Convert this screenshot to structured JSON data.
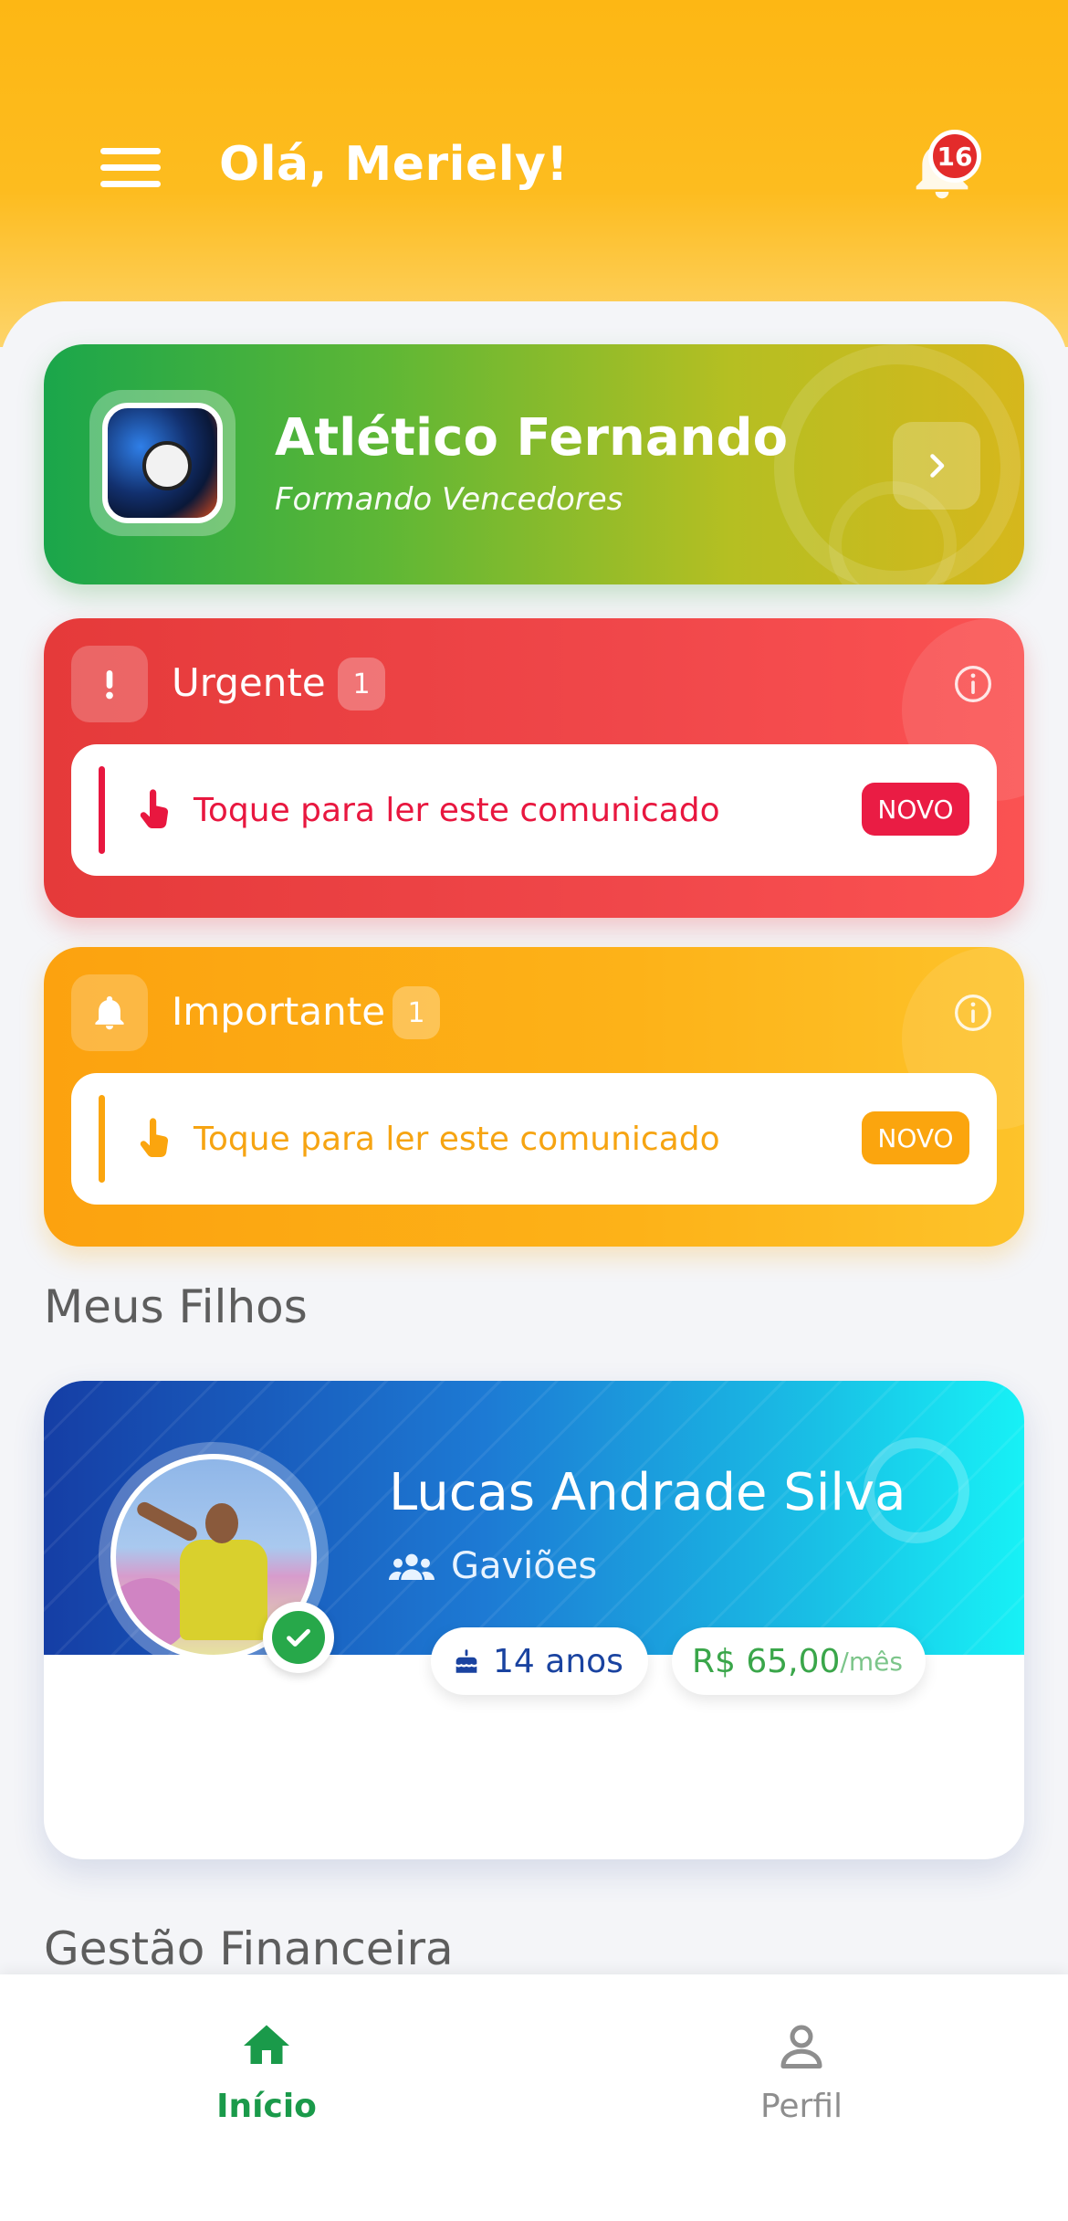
{
  "header": {
    "greeting": "Olá, Meriely!",
    "notification_count": "16"
  },
  "club": {
    "name": "Atlético Fernando",
    "slogan": "Formando Vencedores"
  },
  "urgent": {
    "title": "Urgente",
    "count": "1",
    "message": "Toque para ler este comunicado",
    "badge": "NOVO",
    "color": "#e53a3a",
    "accent": "#e8173f"
  },
  "important": {
    "title": "Importante",
    "count": "1",
    "message": "Toque para ler este comunicado",
    "badge": "NOVO",
    "color": "#fca20f",
    "accent": "#fba50e"
  },
  "sections": {
    "children": "Meus Filhos",
    "finance": "Gestão Financeira"
  },
  "child": {
    "name": "Lucas Andrade Silva",
    "team": "Gaviões",
    "age": "14 anos",
    "fee": "R$ 65,00",
    "fee_unit": "/mês",
    "verified": true
  },
  "bottom_nav": {
    "home": "Início",
    "profile": "Perfil",
    "active": "home",
    "active_color": "#1a9a4a"
  },
  "icons": [
    "menu-icon",
    "bell-icon",
    "chevron-right-icon",
    "exclamation-icon",
    "info-icon",
    "hand-pointer-icon",
    "users-icon",
    "cake-icon",
    "check-icon",
    "home-icon",
    "user-icon",
    "soccer-ball-icon"
  ]
}
